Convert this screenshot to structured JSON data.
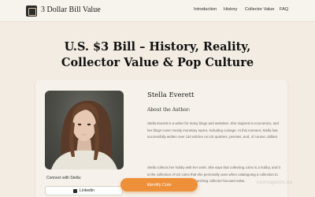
{
  "header": {
    "site_name": "3 Dollar Bill Value",
    "nav": [
      "Introduction",
      "History",
      "Collector Value",
      "FAQ"
    ]
  },
  "hero": {
    "title_line1": "U.S. $3 Bill – History, Reality,",
    "title_line2": "Collector Value & Pop Culture"
  },
  "author": {
    "name": "Stella Everett",
    "label": "About the Author:",
    "bio_1": "Stella Everett is a writer for many blogs and websites. She majored in economics, and her blogs cover mostly monetary topics, including coinage. At this moment, Stella has successfully written over 110 articles on US quarters, pennies, and, of course, dollars.",
    "bio_2": "Stella collects her hobby with her work. She says that collecting coins is a hobby, and it is the collection of US coins that she personally uses when cataloguing a collection to help identify coins for those researching collector-focused value.",
    "connect_label": "Connect with Stella:",
    "linkedin_label": "Linkedin"
  },
  "cta": {
    "identify_label": "Identify Coin"
  },
  "watermark": "coinsqpoint.co",
  "colors": {
    "accent": "#ee8f3a",
    "background": "#f2ece3"
  }
}
